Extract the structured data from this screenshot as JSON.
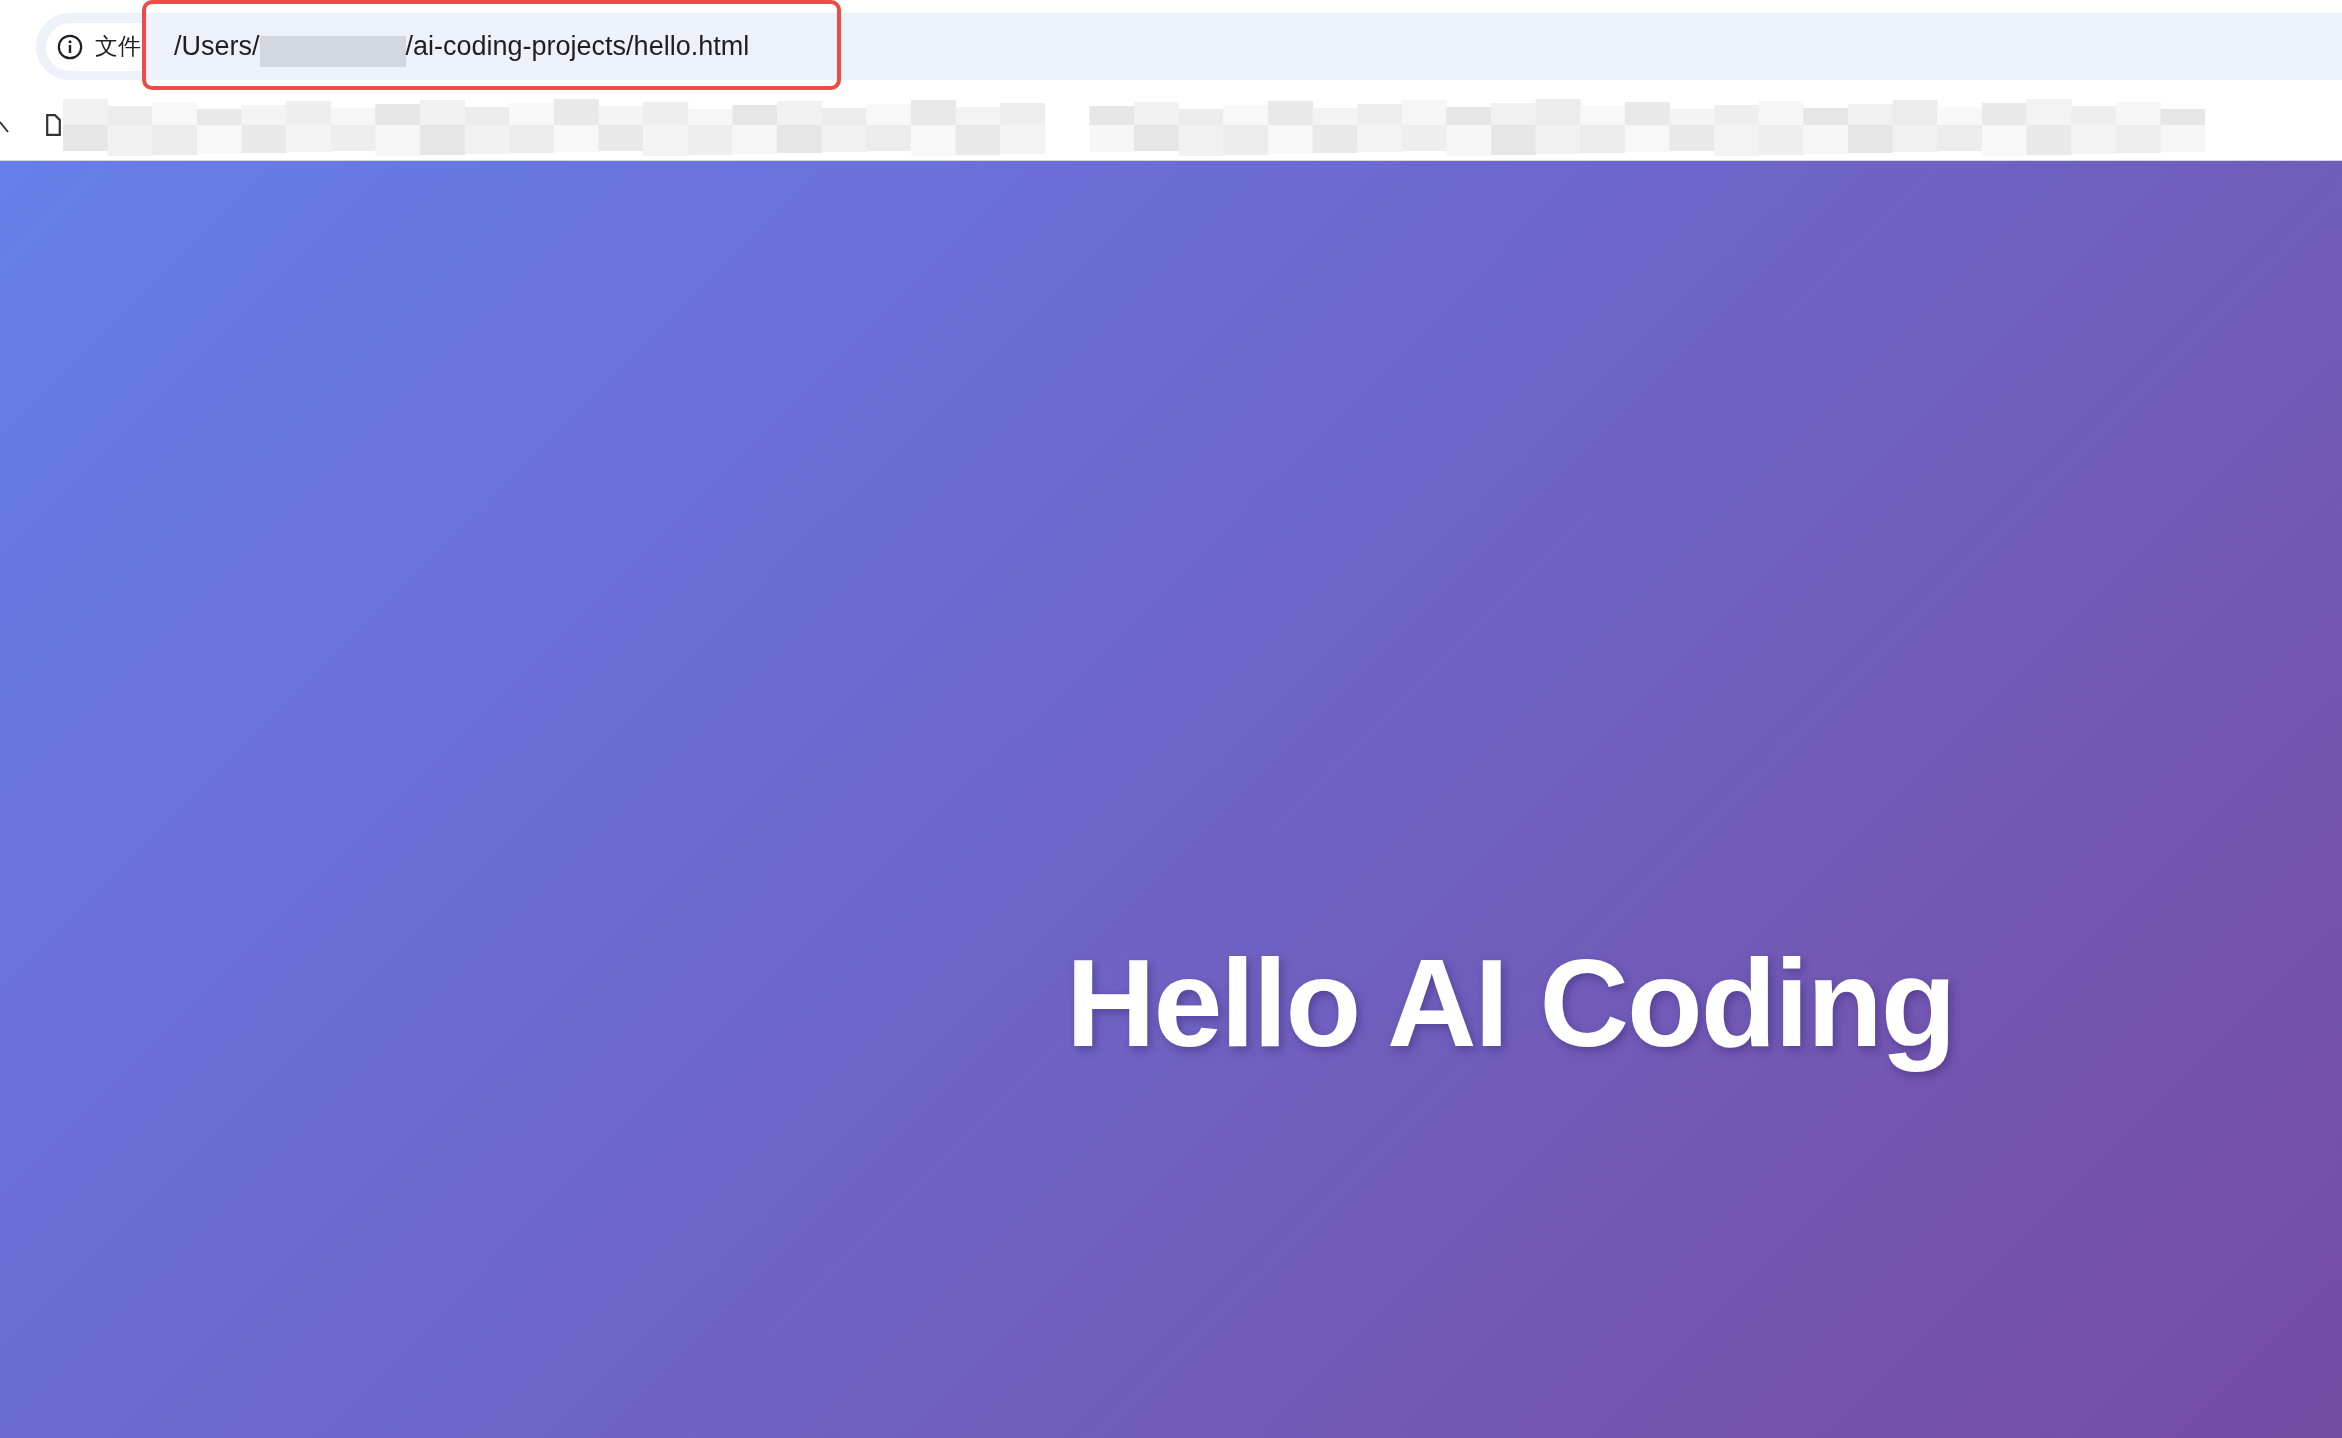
{
  "address_bar": {
    "site_info_label": "文件",
    "url_prefix": "/Users/",
    "url_suffix": "/ai-coding-projects/hello.html",
    "highlighted": true
  },
  "page": {
    "heading": "Hello AI Coding"
  }
}
